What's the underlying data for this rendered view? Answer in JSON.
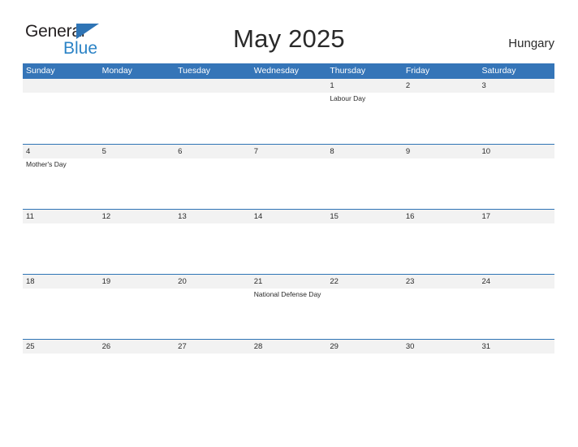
{
  "brand": {
    "name_part1": "General",
    "name_part2": "Blue",
    "flag_icon": "blue-triangle-flag",
    "color_dark": "#231f20",
    "color_blue": "#2b83c6"
  },
  "header": {
    "title": "May 2025",
    "country": "Hungary"
  },
  "colors": {
    "header_bar": "#3575b8",
    "row_band": "#f2f2f2",
    "row_divider": "#2e74b5",
    "text": "#2a2a2a"
  },
  "calendar": {
    "month": "May",
    "year": "2025",
    "day_headers": [
      "Sunday",
      "Monday",
      "Tuesday",
      "Wednesday",
      "Thursday",
      "Friday",
      "Saturday"
    ],
    "weeks": [
      {
        "days": [
          {
            "num": "",
            "events": []
          },
          {
            "num": "",
            "events": []
          },
          {
            "num": "",
            "events": []
          },
          {
            "num": "",
            "events": []
          },
          {
            "num": "1",
            "events": [
              "Labour Day"
            ]
          },
          {
            "num": "2",
            "events": []
          },
          {
            "num": "3",
            "events": []
          }
        ]
      },
      {
        "days": [
          {
            "num": "4",
            "events": [
              "Mother's Day"
            ]
          },
          {
            "num": "5",
            "events": []
          },
          {
            "num": "6",
            "events": []
          },
          {
            "num": "7",
            "events": []
          },
          {
            "num": "8",
            "events": []
          },
          {
            "num": "9",
            "events": []
          },
          {
            "num": "10",
            "events": []
          }
        ]
      },
      {
        "days": [
          {
            "num": "11",
            "events": []
          },
          {
            "num": "12",
            "events": []
          },
          {
            "num": "13",
            "events": []
          },
          {
            "num": "14",
            "events": []
          },
          {
            "num": "15",
            "events": []
          },
          {
            "num": "16",
            "events": []
          },
          {
            "num": "17",
            "events": []
          }
        ]
      },
      {
        "days": [
          {
            "num": "18",
            "events": []
          },
          {
            "num": "19",
            "events": []
          },
          {
            "num": "20",
            "events": []
          },
          {
            "num": "21",
            "events": [
              "National Defense Day"
            ]
          },
          {
            "num": "22",
            "events": []
          },
          {
            "num": "23",
            "events": []
          },
          {
            "num": "24",
            "events": []
          }
        ]
      },
      {
        "days": [
          {
            "num": "25",
            "events": []
          },
          {
            "num": "26",
            "events": []
          },
          {
            "num": "27",
            "events": []
          },
          {
            "num": "28",
            "events": []
          },
          {
            "num": "29",
            "events": []
          },
          {
            "num": "30",
            "events": []
          },
          {
            "num": "31",
            "events": []
          }
        ]
      }
    ]
  }
}
